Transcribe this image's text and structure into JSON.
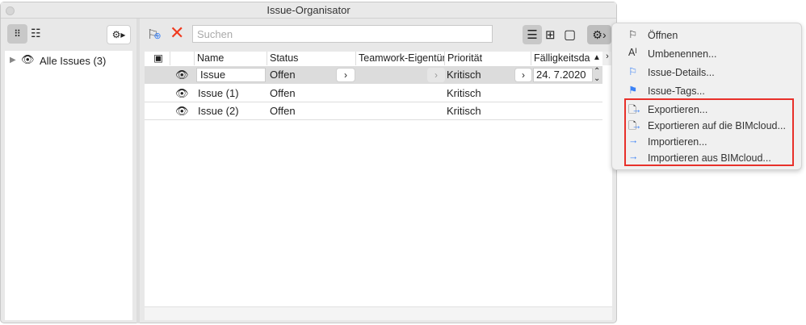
{
  "window": {
    "title": "Issue-Organisator"
  },
  "sidebar": {
    "tree_item": "Alle Issues (3)"
  },
  "toolbar": {
    "search_placeholder": "Suchen"
  },
  "table": {
    "headers": [
      "Name",
      "Status",
      "Teamwork-Eigentümer",
      "Priorität",
      "Fälligkeitsda"
    ],
    "rows": [
      {
        "name": "Issue",
        "status": "Offen",
        "priority": "Kritisch",
        "due": "24.  7.2020"
      },
      {
        "name": "Issue (1)",
        "status": "Offen",
        "priority": "Kritisch",
        "due": ""
      },
      {
        "name": "Issue (2)",
        "status": "Offen",
        "priority": "Kritisch",
        "due": ""
      }
    ]
  },
  "menu": {
    "items": [
      "Öffnen",
      "Umbenennen...",
      "Issue-Details...",
      "Issue-Tags...",
      "Exportieren...",
      "Exportieren auf die BIMcloud...",
      "Importieren...",
      "Importieren aus BIMcloud..."
    ]
  },
  "colors": {
    "highlight": "#e8302a",
    "accent": "#3b82f6",
    "delete": "#f03a1e"
  }
}
